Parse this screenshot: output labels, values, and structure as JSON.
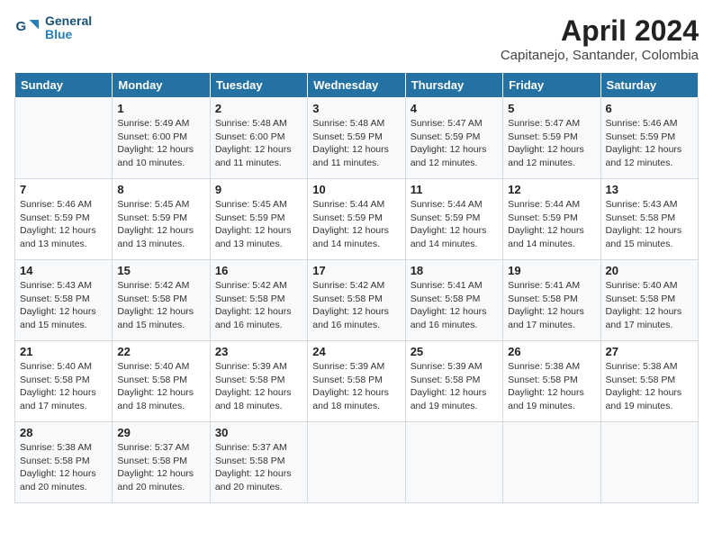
{
  "header": {
    "logo_line1": "General",
    "logo_line2": "Blue",
    "month_year": "April 2024",
    "location": "Capitanejo, Santander, Colombia"
  },
  "weekdays": [
    "Sunday",
    "Monday",
    "Tuesday",
    "Wednesday",
    "Thursday",
    "Friday",
    "Saturday"
  ],
  "weeks": [
    [
      {
        "day": "",
        "sunrise": "",
        "sunset": "",
        "daylight": ""
      },
      {
        "day": "1",
        "sunrise": "Sunrise: 5:49 AM",
        "sunset": "Sunset: 6:00 PM",
        "daylight": "Daylight: 12 hours and 10 minutes."
      },
      {
        "day": "2",
        "sunrise": "Sunrise: 5:48 AM",
        "sunset": "Sunset: 6:00 PM",
        "daylight": "Daylight: 12 hours and 11 minutes."
      },
      {
        "day": "3",
        "sunrise": "Sunrise: 5:48 AM",
        "sunset": "Sunset: 5:59 PM",
        "daylight": "Daylight: 12 hours and 11 minutes."
      },
      {
        "day": "4",
        "sunrise": "Sunrise: 5:47 AM",
        "sunset": "Sunset: 5:59 PM",
        "daylight": "Daylight: 12 hours and 12 minutes."
      },
      {
        "day": "5",
        "sunrise": "Sunrise: 5:47 AM",
        "sunset": "Sunset: 5:59 PM",
        "daylight": "Daylight: 12 hours and 12 minutes."
      },
      {
        "day": "6",
        "sunrise": "Sunrise: 5:46 AM",
        "sunset": "Sunset: 5:59 PM",
        "daylight": "Daylight: 12 hours and 12 minutes."
      }
    ],
    [
      {
        "day": "7",
        "sunrise": "Sunrise: 5:46 AM",
        "sunset": "Sunset: 5:59 PM",
        "daylight": "Daylight: 12 hours and 13 minutes."
      },
      {
        "day": "8",
        "sunrise": "Sunrise: 5:45 AM",
        "sunset": "Sunset: 5:59 PM",
        "daylight": "Daylight: 12 hours and 13 minutes."
      },
      {
        "day": "9",
        "sunrise": "Sunrise: 5:45 AM",
        "sunset": "Sunset: 5:59 PM",
        "daylight": "Daylight: 12 hours and 13 minutes."
      },
      {
        "day": "10",
        "sunrise": "Sunrise: 5:44 AM",
        "sunset": "Sunset: 5:59 PM",
        "daylight": "Daylight: 12 hours and 14 minutes."
      },
      {
        "day": "11",
        "sunrise": "Sunrise: 5:44 AM",
        "sunset": "Sunset: 5:59 PM",
        "daylight": "Daylight: 12 hours and 14 minutes."
      },
      {
        "day": "12",
        "sunrise": "Sunrise: 5:44 AM",
        "sunset": "Sunset: 5:59 PM",
        "daylight": "Daylight: 12 hours and 14 minutes."
      },
      {
        "day": "13",
        "sunrise": "Sunrise: 5:43 AM",
        "sunset": "Sunset: 5:58 PM",
        "daylight": "Daylight: 12 hours and 15 minutes."
      }
    ],
    [
      {
        "day": "14",
        "sunrise": "Sunrise: 5:43 AM",
        "sunset": "Sunset: 5:58 PM",
        "daylight": "Daylight: 12 hours and 15 minutes."
      },
      {
        "day": "15",
        "sunrise": "Sunrise: 5:42 AM",
        "sunset": "Sunset: 5:58 PM",
        "daylight": "Daylight: 12 hours and 15 minutes."
      },
      {
        "day": "16",
        "sunrise": "Sunrise: 5:42 AM",
        "sunset": "Sunset: 5:58 PM",
        "daylight": "Daylight: 12 hours and 16 minutes."
      },
      {
        "day": "17",
        "sunrise": "Sunrise: 5:42 AM",
        "sunset": "Sunset: 5:58 PM",
        "daylight": "Daylight: 12 hours and 16 minutes."
      },
      {
        "day": "18",
        "sunrise": "Sunrise: 5:41 AM",
        "sunset": "Sunset: 5:58 PM",
        "daylight": "Daylight: 12 hours and 16 minutes."
      },
      {
        "day": "19",
        "sunrise": "Sunrise: 5:41 AM",
        "sunset": "Sunset: 5:58 PM",
        "daylight": "Daylight: 12 hours and 17 minutes."
      },
      {
        "day": "20",
        "sunrise": "Sunrise: 5:40 AM",
        "sunset": "Sunset: 5:58 PM",
        "daylight": "Daylight: 12 hours and 17 minutes."
      }
    ],
    [
      {
        "day": "21",
        "sunrise": "Sunrise: 5:40 AM",
        "sunset": "Sunset: 5:58 PM",
        "daylight": "Daylight: 12 hours and 17 minutes."
      },
      {
        "day": "22",
        "sunrise": "Sunrise: 5:40 AM",
        "sunset": "Sunset: 5:58 PM",
        "daylight": "Daylight: 12 hours and 18 minutes."
      },
      {
        "day": "23",
        "sunrise": "Sunrise: 5:39 AM",
        "sunset": "Sunset: 5:58 PM",
        "daylight": "Daylight: 12 hours and 18 minutes."
      },
      {
        "day": "24",
        "sunrise": "Sunrise: 5:39 AM",
        "sunset": "Sunset: 5:58 PM",
        "daylight": "Daylight: 12 hours and 18 minutes."
      },
      {
        "day": "25",
        "sunrise": "Sunrise: 5:39 AM",
        "sunset": "Sunset: 5:58 PM",
        "daylight": "Daylight: 12 hours and 19 minutes."
      },
      {
        "day": "26",
        "sunrise": "Sunrise: 5:38 AM",
        "sunset": "Sunset: 5:58 PM",
        "daylight": "Daylight: 12 hours and 19 minutes."
      },
      {
        "day": "27",
        "sunrise": "Sunrise: 5:38 AM",
        "sunset": "Sunset: 5:58 PM",
        "daylight": "Daylight: 12 hours and 19 minutes."
      }
    ],
    [
      {
        "day": "28",
        "sunrise": "Sunrise: 5:38 AM",
        "sunset": "Sunset: 5:58 PM",
        "daylight": "Daylight: 12 hours and 20 minutes."
      },
      {
        "day": "29",
        "sunrise": "Sunrise: 5:37 AM",
        "sunset": "Sunset: 5:58 PM",
        "daylight": "Daylight: 12 hours and 20 minutes."
      },
      {
        "day": "30",
        "sunrise": "Sunrise: 5:37 AM",
        "sunset": "Sunset: 5:58 PM",
        "daylight": "Daylight: 12 hours and 20 minutes."
      },
      {
        "day": "",
        "sunrise": "",
        "sunset": "",
        "daylight": ""
      },
      {
        "day": "",
        "sunrise": "",
        "sunset": "",
        "daylight": ""
      },
      {
        "day": "",
        "sunrise": "",
        "sunset": "",
        "daylight": ""
      },
      {
        "day": "",
        "sunrise": "",
        "sunset": "",
        "daylight": ""
      }
    ]
  ]
}
